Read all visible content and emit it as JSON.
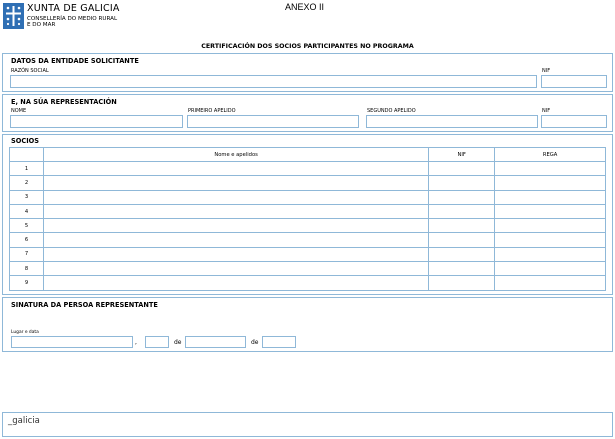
{
  "header": {
    "org_title": "XUNTA DE GALICIA",
    "org_sub1": "CONSELLERÍA DO MEDIO RURAL",
    "org_sub2": "E DO MAR",
    "annex": "ANEXO II",
    "doc_title": "CERTIFICACIÓN DOS SOCIOS PARTICIPANTES NO PROGRAMA"
  },
  "entity": {
    "title": "DATOS DA ENTIDADE SOLICITANTE",
    "razon_label": "RAZÓN SOCIAL",
    "nif_label": "NIF",
    "razon_value": "",
    "nif_value": ""
  },
  "representation": {
    "title": "E, NA SÚA REPRESENTACIÓN",
    "name_label": "NOME",
    "first_surname_label": "PRIMEIRO APELIDO",
    "second_surname_label": "SEGUNDO APELIDO",
    "nif_label": "NIF",
    "name_value": "",
    "first_surname_value": "",
    "second_surname_value": "",
    "nif_value": ""
  },
  "socios": {
    "title": "SOCIOS",
    "columns": [
      "",
      "Nome e apelidos",
      "NIF",
      "REGA"
    ],
    "rows": [
      "1",
      "2",
      "3",
      "4",
      "5",
      "6",
      "7",
      "8",
      "9"
    ]
  },
  "signature": {
    "title": "SINATURA DA PERSOA REPRESENTANTE",
    "place_date_label": "Lugar e data",
    "comma": ",",
    "de1": "de",
    "de2": "de",
    "place_value": "",
    "day_value": "",
    "month_value": "",
    "year_value": ""
  },
  "footer": {
    "brand": "_galicia"
  },
  "colors": {
    "border": "#8fb8d8",
    "logo_blue": "#2f6fb4"
  }
}
